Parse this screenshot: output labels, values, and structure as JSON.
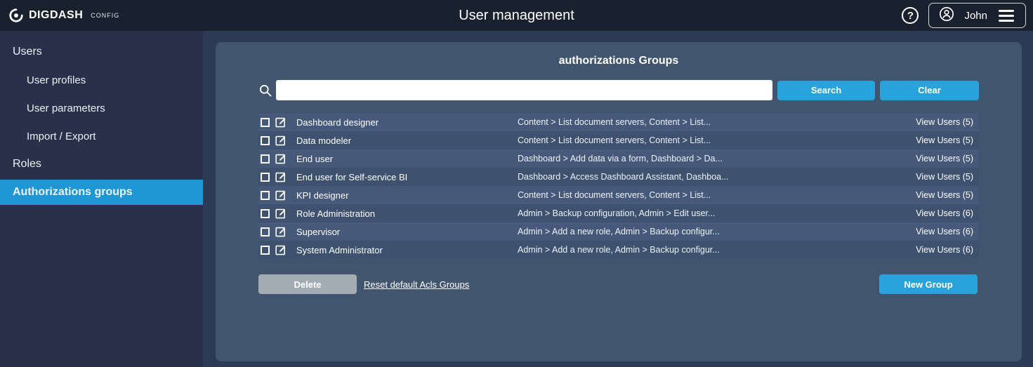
{
  "topbar": {
    "brand": "DIGDASH",
    "brand_suffix": "CONFIG",
    "title": "User management",
    "help_icon": "?",
    "user_name": "John"
  },
  "sidebar": {
    "items": [
      {
        "label": "Users",
        "indent": 0,
        "active": false
      },
      {
        "label": "User profiles",
        "indent": 1,
        "active": false
      },
      {
        "label": "User parameters",
        "indent": 1,
        "active": false
      },
      {
        "label": "Import / Export",
        "indent": 1,
        "active": false
      },
      {
        "label": "Roles",
        "indent": 0,
        "active": false
      },
      {
        "label": "Authorizations groups",
        "indent": 0,
        "active": true
      }
    ]
  },
  "panel": {
    "title": "authorizations Groups",
    "search": {
      "value": "",
      "placeholder": "",
      "search_label": "Search",
      "clear_label": "Clear"
    },
    "groups": [
      {
        "name": "Dashboard designer",
        "permissions": "Content > List document servers, Content > List...",
        "view_users": "View Users (5)"
      },
      {
        "name": "Data modeler",
        "permissions": "Content > List document servers, Content > List...",
        "view_users": "View Users (5)"
      },
      {
        "name": "End user",
        "permissions": "Dashboard > Add data via a form, Dashboard > Da...",
        "view_users": "View Users (5)"
      },
      {
        "name": "End user for Self-service BI",
        "permissions": "Dashboard > Access Dashboard Assistant, Dashboa...",
        "view_users": "View Users (5)"
      },
      {
        "name": "KPI designer",
        "permissions": "Content > List document servers, Content > List...",
        "view_users": "View Users (5)"
      },
      {
        "name": "Role Administration",
        "permissions": "Admin > Backup configuration, Admin > Edit user...",
        "view_users": "View Users (6)"
      },
      {
        "name": "Supervisor",
        "permissions": "Admin > Add a new role, Admin > Backup configur...",
        "view_users": "View Users (6)"
      },
      {
        "name": "System Administrator",
        "permissions": "Admin > Add a new role, Admin > Backup configur...",
        "view_users": "View Users (6)"
      }
    ],
    "footer": {
      "delete_label": "Delete",
      "reset_link": "Reset default Acls Groups",
      "new_group_label": "New Group"
    }
  },
  "colors": {
    "accent": "#29a3dc",
    "sidebar_active": "#1f97d4",
    "topbar_bg": "#19212f",
    "sidebar_bg": "#28304a",
    "panel_bg": "#41556f",
    "row_bg": "#46597a",
    "row_alt_bg": "#3e5270",
    "delete_disabled": "#a3abb4"
  }
}
